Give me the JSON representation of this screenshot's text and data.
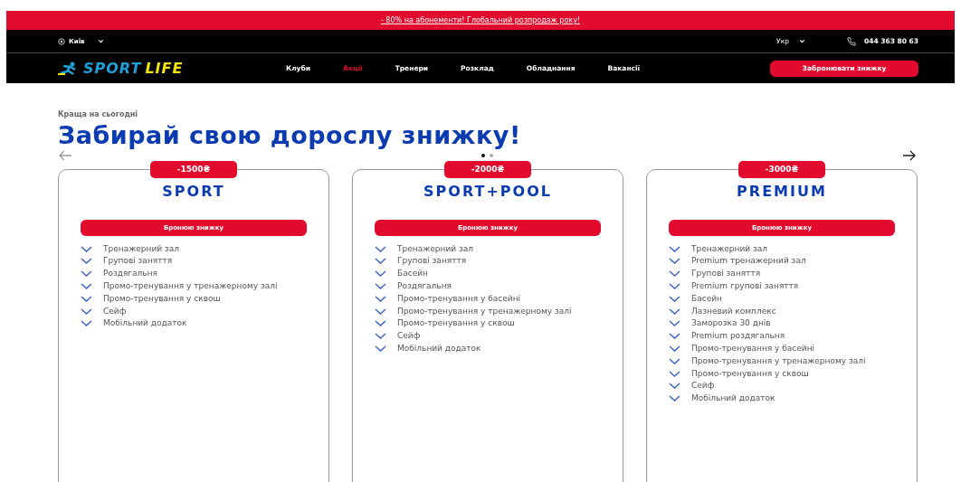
{
  "promo_bar": {
    "text": "- 80% на абонементи! Глобальний розпродаж року!"
  },
  "top_bar": {
    "city": "Київ",
    "language": "Укр",
    "phone": "044 363 80 63"
  },
  "logo": {
    "words": [
      "SPORT",
      "LIFE"
    ]
  },
  "nav": [
    {
      "label": "Клуби",
      "selected": false
    },
    {
      "label": "Акції",
      "selected": true
    },
    {
      "label": "Тренери",
      "selected": false
    },
    {
      "label": "Розклад",
      "selected": false
    },
    {
      "label": "Обладнання",
      "selected": false
    },
    {
      "label": "Вакансії",
      "selected": false
    }
  ],
  "cta_button": "Забронювати знижку",
  "section": {
    "eyebrow": "Краща на сьогодні",
    "title": "Забирай свою дорослу знижку!"
  },
  "carousel_dots": [
    {
      "selected": true
    },
    {
      "selected": false
    }
  ],
  "plans": [
    {
      "discount": "-1500₴",
      "name": "SPORT",
      "button": "Бронюю знижку",
      "features": [
        "Тренажерний зал",
        "Групові заняття",
        "Роздягальня",
        "Промо-тренування у тренажерному залі",
        "Промо-тренування у сквош",
        "Сейф",
        "Мобільний додаток"
      ]
    },
    {
      "discount": "-2000₴",
      "name": "SPORT+POOL",
      "button": "Бронюю знижку",
      "features": [
        "Тренажерний зал",
        "Групові заняття",
        "Басейн",
        "Роздягальня",
        "Промо-тренування у басейні",
        "Промо-тренування у тренажерному залі",
        "Промо-тренування у сквош",
        "Сейф",
        "Мобільний додаток"
      ]
    },
    {
      "discount": "-3000₴",
      "name": "PREMIUM",
      "button": "Бронюю знижку",
      "features": [
        "Тренажерний зал",
        "Premium тренажерний зал",
        "Групові заняття",
        "Premium групові заняття",
        "Басейн",
        "Лазневий комплекс",
        "Заморозка 30 днів",
        "Premium роздягальня",
        "Промо-тренування у басейні",
        "Промо-тренування у тренажерному залі",
        "Промо-тренування у сквош",
        "Сейф",
        "Мобільний додаток"
      ]
    }
  ]
}
